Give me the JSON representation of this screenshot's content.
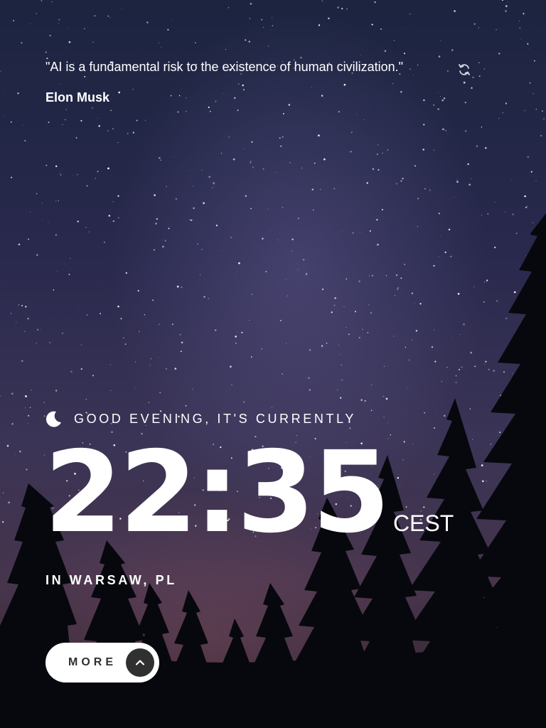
{
  "quote": {
    "text": "\"AI is a fundamental risk to the existence of human civilization.\"",
    "author": "Elon Musk",
    "refresh_icon": "refresh-icon"
  },
  "greeting": {
    "icon": "moon-icon",
    "text": "GOOD EVENING, IT'S CURRENTLY"
  },
  "clock": {
    "time": "22:35",
    "timezone": "CEST"
  },
  "location": {
    "text": "IN WARSAW, PL"
  },
  "more_button": {
    "label": "MORE",
    "icon": "chevron-up-icon"
  },
  "colors": {
    "text": "#ffffff",
    "button_bg": "#ffffff",
    "button_text": "#303030",
    "button_icon_bg": "#303030"
  }
}
